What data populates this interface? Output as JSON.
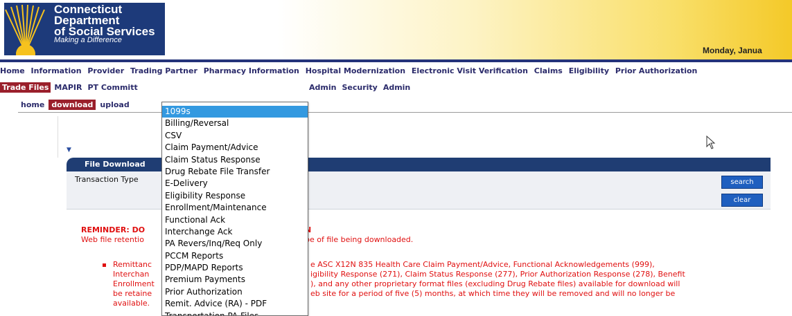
{
  "header": {
    "logo_title_line1": "Connecticut Department",
    "logo_title_line2": "of Social Services",
    "logo_tagline": "Making a Difference",
    "date": "Monday, Janua"
  },
  "nav_main": [
    "Home",
    "Information",
    "Provider",
    "Trading Partner",
    "Pharmacy Information",
    "Hospital Modernization",
    "Electronic Visit Verification",
    "Claims",
    "Eligibility",
    "Prior Authorization"
  ],
  "nav_secondary": {
    "active": "Trade Files",
    "items": [
      "MAPIR",
      "PT Committ"
    ],
    "right_items": [
      "Admin",
      "Security",
      "Admin"
    ]
  },
  "nav_tertiary": {
    "home": "home",
    "download": "download",
    "upload": "upload"
  },
  "panel": {
    "title": "File Download",
    "transaction_type_label": "Transaction Type",
    "search_button": "search",
    "clear_button": "clear"
  },
  "reminder": {
    "heading": "REMINDER: DO",
    "heading_suffix": "N",
    "retention_prefix": "Web file retentio",
    "retention_suffix": "pe of file being downloaded.",
    "bullet_lines": [
      {
        "left": "Remittanc",
        "right": "e ASC X12N 835 Health Care Claim Payment/Advice, Functional Acknowledgements (999),"
      },
      {
        "left": "Interchan",
        "right": "igibility Response (271), Claim Status Response (277), Prior Authorization Response (278), Benefit"
      },
      {
        "left": "Enrollment",
        "right": "), and any other proprietary format files (excluding Drug Rebate files) available for download will"
      },
      {
        "left": "be retaine",
        "right": "eb site for a period of five (5) months, at which time they will be removed and will no longer be"
      },
      {
        "left": "available.",
        "right": ""
      }
    ]
  },
  "dropdown": {
    "selected": "1099s",
    "options": [
      "1099s",
      "Billing/Reversal",
      "CSV",
      "Claim Payment/Advice",
      "Claim Status Response",
      "Drug Rebate File Transfer",
      "E-Delivery",
      "Eligibility Response",
      "Enrollment/Maintenance",
      "Functional Ack",
      "Interchange Ack",
      "PA Revers/Inq/Req Only",
      "PCCM Reports",
      "PDP/MAPD Reports",
      "Premium Payments",
      "Prior Authorization",
      "Remit. Advice (RA) - PDF",
      "Transportation PA Files"
    ]
  },
  "colors": {
    "brand_navy": "#1d3a7a",
    "active_tab": "#9a1f2b",
    "reminder_red": "#e01010",
    "selected_option": "#3399e0"
  }
}
